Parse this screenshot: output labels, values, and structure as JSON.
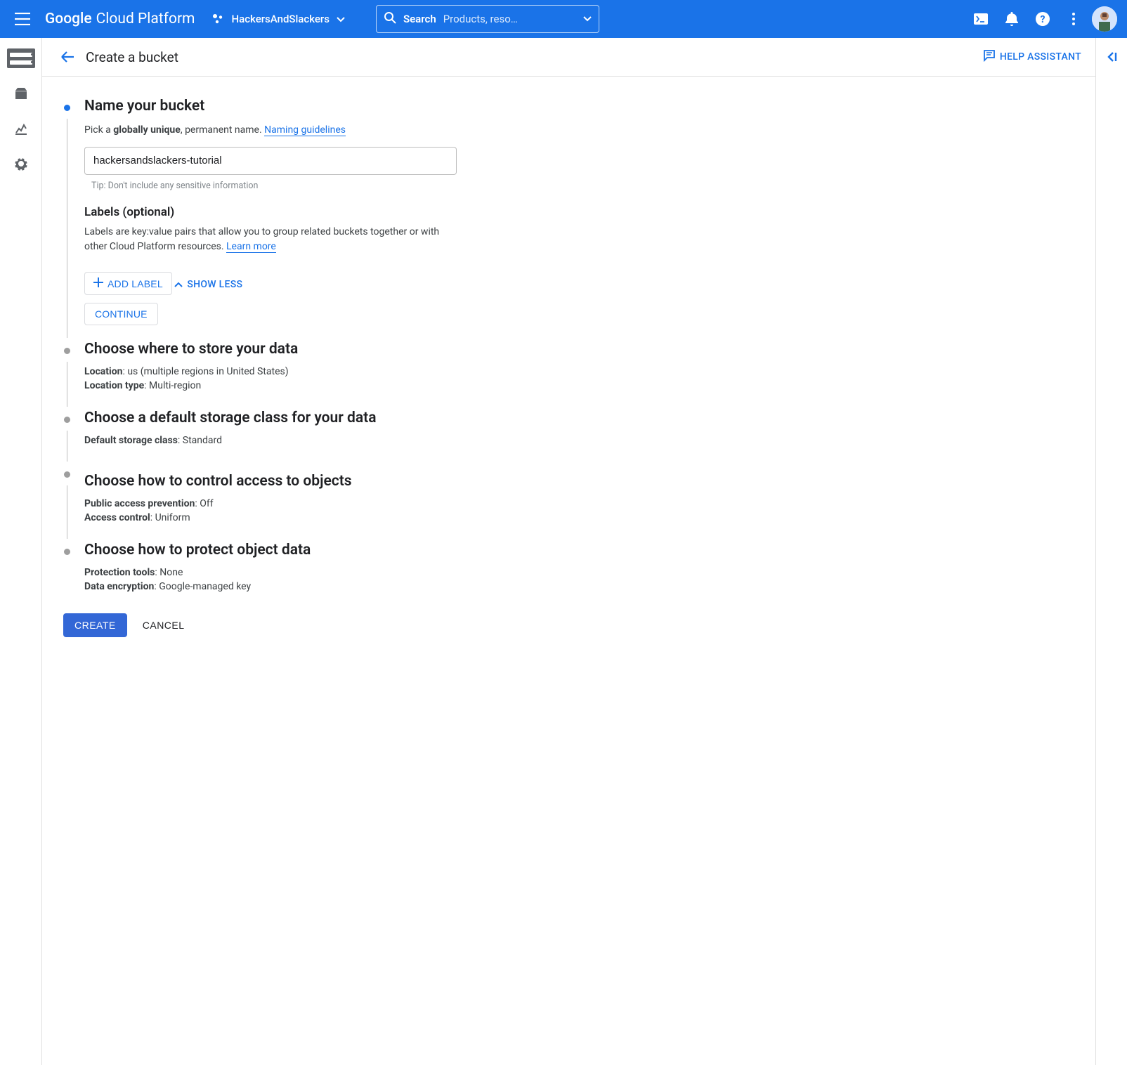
{
  "topbar": {
    "logo_google": "Google",
    "logo_rest": "Cloud Platform",
    "project_name": "HackersAndSlackers",
    "search_label": "Search",
    "search_placeholder": "Products, reso…"
  },
  "header": {
    "title": "Create a bucket",
    "help_assistant": "HELP ASSISTANT"
  },
  "step_name": {
    "title": "Name your bucket",
    "desc_prefix": "Pick a ",
    "desc_bold": "globally unique",
    "desc_suffix": ", permanent name. ",
    "naming_link": "Naming guidelines",
    "input_value": "hackersandslackers-tutorial",
    "tip": "Tip: Don't include any sensitive information",
    "labels_title": "Labels (optional)",
    "labels_desc": "Labels are key:value pairs that allow you to group related buckets together or with other Cloud Platform resources. ",
    "learn_more": "Learn more",
    "add_label": "ADD LABEL",
    "show_less": "SHOW LESS",
    "continue": "CONTINUE"
  },
  "step_location": {
    "title": "Choose where to store your data",
    "l1_label": "Location",
    "l1_val": ": us (multiple regions in United States)",
    "l2_label": "Location type",
    "l2_val": ": Multi-region"
  },
  "step_class": {
    "title": "Choose a default storage class for your data",
    "l1_label": "Default storage class",
    "l1_val": ": Standard"
  },
  "step_access": {
    "title": "Choose how to control access to objects",
    "l1_label": "Public access prevention",
    "l1_val": ": Off",
    "l2_label": "Access control",
    "l2_val": ": Uniform"
  },
  "step_protect": {
    "title": "Choose how to protect object data",
    "l1_label": "Protection tools",
    "l1_val": ": None",
    "l2_label": "Data encryption",
    "l2_val": ": Google-managed key"
  },
  "actions": {
    "create": "CREATE",
    "cancel": "CANCEL"
  }
}
